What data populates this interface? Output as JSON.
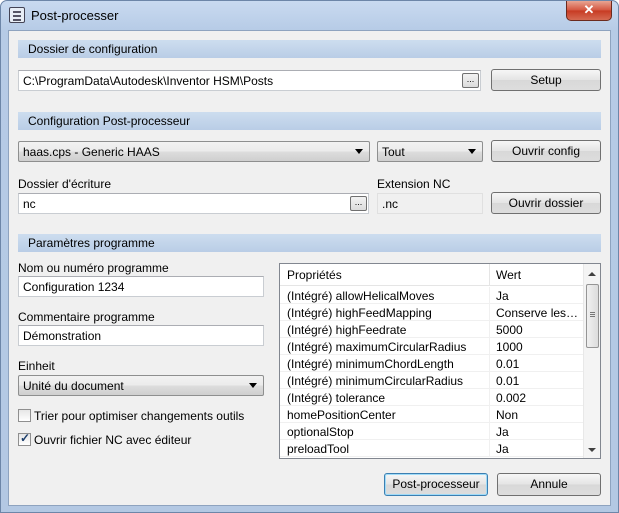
{
  "window": {
    "title": "Post-processer",
    "close_label": "✕"
  },
  "config_section": {
    "header": "Dossier de configuration",
    "path_value": "C:\\ProgramData\\Autodesk\\Inventor HSM\\Posts",
    "browse_label": "...",
    "setup_label": "Setup"
  },
  "post_section": {
    "header": "Configuration Post-processeur",
    "post_select": "haas.cps - Generic HAAS",
    "filter_select": "Tout",
    "open_config_label": "Ouvrir config",
    "output_folder_label": "Dossier d'écriture",
    "output_folder_value": "nc",
    "browse_label": "...",
    "extension_label": "Extension NC",
    "extension_value": ".nc",
    "open_folder_label": "Ouvrir dossier"
  },
  "program_section": {
    "header": "Paramètres programme",
    "name_label": "Nom ou numéro programme",
    "name_value": "Configuration 1234",
    "comment_label": "Commentaire programme",
    "comment_value": "Démonstration",
    "unit_label": "Einheit",
    "unit_value": "Unité du document",
    "sort_checkbox_label": "Trier pour optimiser changements outils",
    "sort_checked": false,
    "open_nc_checkbox_label": "Ouvrir fichier NC avec éditeur",
    "open_nc_checked": true
  },
  "properties": {
    "col_property": "Propriétés",
    "col_value": "Wert",
    "rows": [
      {
        "property": "(Intégré) allowHelicalMoves",
        "value": "Ja"
      },
      {
        "property": "(Intégré) highFeedMapping",
        "value": "Conserve les …"
      },
      {
        "property": "(Intégré) highFeedrate",
        "value": "5000"
      },
      {
        "property": "(Intégré) maximumCircularRadius",
        "value": "1000"
      },
      {
        "property": "(Intégré) minimumChordLength",
        "value": "0.01"
      },
      {
        "property": "(Intégré) minimumCircularRadius",
        "value": "0.01"
      },
      {
        "property": "(Intégré) tolerance",
        "value": "0.002"
      },
      {
        "property": "homePositionCenter",
        "value": "Non"
      },
      {
        "property": "optionalStop",
        "value": "Ja"
      },
      {
        "property": "preloadTool",
        "value": "Ja"
      }
    ]
  },
  "footer": {
    "post_label": "Post-processeur",
    "cancel_label": "Annule"
  }
}
